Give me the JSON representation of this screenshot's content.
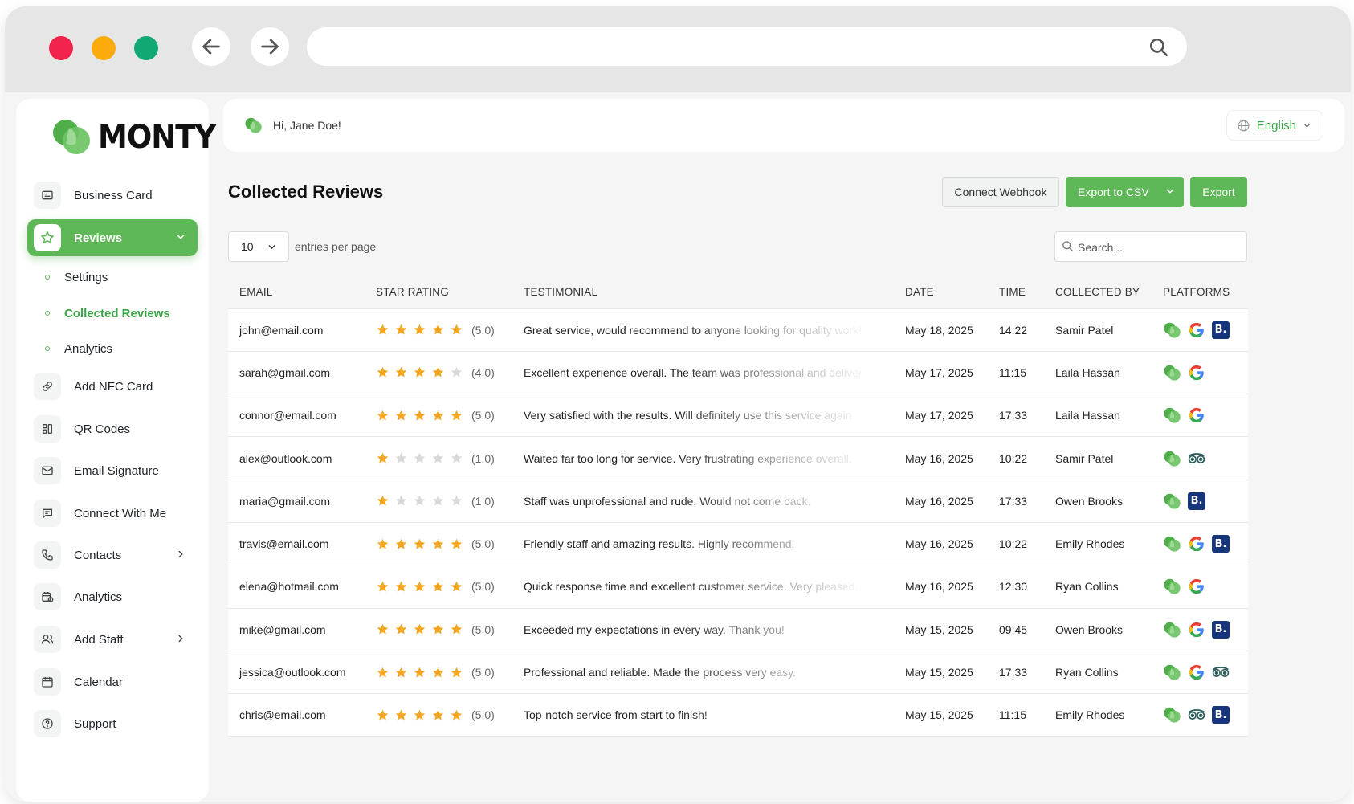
{
  "browser": {
    "url": "",
    "controls": {
      "back": "arrow-left-icon",
      "forward": "arrow-right-icon",
      "search": "search-icon"
    },
    "traffic_lights": [
      "#f2234d",
      "#fbab0c",
      "#10a873"
    ]
  },
  "brand": {
    "name": "MONTY",
    "accent": "#5eb858"
  },
  "sidebar": {
    "items": [
      {
        "label": "Business Card",
        "icon": "id-card-icon"
      },
      {
        "label": "Reviews",
        "icon": "star-icon",
        "active": true,
        "expanded": true
      },
      {
        "label": "Add NFC Card",
        "icon": "link-icon"
      },
      {
        "label": "QR Codes",
        "icon": "qr-code-icon"
      },
      {
        "label": "Email Signature",
        "icon": "mail-icon"
      },
      {
        "label": "Connect With Me",
        "icon": "chat-icon"
      },
      {
        "label": "Contacts",
        "icon": "phone-icon",
        "has_submenu": true
      },
      {
        "label": "Analytics",
        "icon": "calendar-chart-icon"
      },
      {
        "label": "Add Staff",
        "icon": "users-icon",
        "has_submenu": true
      },
      {
        "label": "Calendar",
        "icon": "calendar-icon"
      },
      {
        "label": "Support",
        "icon": "help-icon"
      }
    ],
    "reviews_sub": [
      {
        "label": "Settings"
      },
      {
        "label": "Collected Reviews",
        "current": true
      },
      {
        "label": "Analytics"
      }
    ]
  },
  "header": {
    "greeting": "Hi, Jane Doe!",
    "language": "English"
  },
  "main": {
    "title": "Collected Reviews",
    "buttons": {
      "webhook": "Connect Webhook",
      "csv": "Export to CSV",
      "export": "Export"
    },
    "entries": {
      "value": "10",
      "label": "entries per page"
    },
    "search_placeholder": "Search...",
    "columns": [
      "EMAIL",
      "STAR RATING",
      "TESTIMONIAL",
      "DATE",
      "TIME",
      "COLLECTED BY",
      "PLATFORMS"
    ],
    "rows": [
      {
        "email": "john@email.com",
        "rating": 5,
        "rating_text": "(5.0)",
        "testimonial": "Great service, would recommend to anyone looking for quality work!",
        "date": "May 18, 2025",
        "time": "14:22",
        "collected_by": "Samir Patel",
        "platforms": [
          "monty",
          "google",
          "booking"
        ]
      },
      {
        "email": "sarah@gmail.com",
        "rating": 4,
        "rating_text": "(4.0)",
        "testimonial": "Excellent experience overall. The team was professional and delivered",
        "date": "May 17, 2025",
        "time": "11:15",
        "collected_by": "Laila Hassan",
        "platforms": [
          "monty",
          "google"
        ]
      },
      {
        "email": "connor@email.com",
        "rating": 5,
        "rating_text": "(5.0)",
        "testimonial": "Very satisfied with the results. Will definitely use this service again.",
        "date": "May 17, 2025",
        "time": "17:33",
        "collected_by": "Laila Hassan",
        "platforms": [
          "monty",
          "google"
        ]
      },
      {
        "email": "alex@outlook.com",
        "rating": 1,
        "rating_text": "(1.0)",
        "testimonial": "Waited far too long for service. Very frustrating experience overall.",
        "date": "May 16, 2025",
        "time": "10:22",
        "collected_by": "Samir Patel",
        "platforms": [
          "monty",
          "tripadvisor"
        ]
      },
      {
        "email": "maria@gmail.com",
        "rating": 1,
        "rating_text": "(1.0)",
        "testimonial": "Staff was unprofessional and rude. Would not come back.",
        "date": "May 16, 2025",
        "time": "17:33",
        "collected_by": "Owen Brooks",
        "platforms": [
          "monty",
          "booking"
        ]
      },
      {
        "email": "travis@email.com",
        "rating": 5,
        "rating_text": "(5.0)",
        "testimonial": "Friendly staff and amazing results. Highly recommend!",
        "date": "May 16, 2025",
        "time": "10:22",
        "collected_by": "Emily Rhodes",
        "platforms": [
          "monty",
          "google",
          "booking"
        ]
      },
      {
        "email": "elena@hotmail.com",
        "rating": 5,
        "rating_text": "(5.0)",
        "testimonial": "Quick response time and excellent customer service. Very pleased.",
        "date": "May 16, 2025",
        "time": "12:30",
        "collected_by": "Ryan Collins",
        "platforms": [
          "monty",
          "google"
        ]
      },
      {
        "email": "mike@gmail.com",
        "rating": 5,
        "rating_text": "(5.0)",
        "testimonial": "Exceeded my expectations in every way. Thank you!",
        "date": "May 15, 2025",
        "time": "09:45",
        "collected_by": "Owen Brooks",
        "platforms": [
          "monty",
          "google",
          "booking"
        ]
      },
      {
        "email": "jessica@outlook.com",
        "rating": 5,
        "rating_text": "(5.0)",
        "testimonial": "Professional and reliable. Made the process very easy.",
        "date": "May 15, 2025",
        "time": "17:33",
        "collected_by": "Ryan Collins",
        "platforms": [
          "monty",
          "google",
          "tripadvisor"
        ]
      },
      {
        "email": "chris@email.com",
        "rating": 5,
        "rating_text": "(5.0)",
        "testimonial": "Top-notch service from start to finish!",
        "date": "May 15, 2025",
        "time": "11:15",
        "collected_by": "Emily Rhodes",
        "platforms": [
          "monty",
          "tripadvisor",
          "booking"
        ]
      }
    ]
  },
  "colors": {
    "star_filled": "#f5a623",
    "star_empty": "#d9d9d9",
    "booking": "#17357a",
    "google_blue": "#4285f4"
  }
}
